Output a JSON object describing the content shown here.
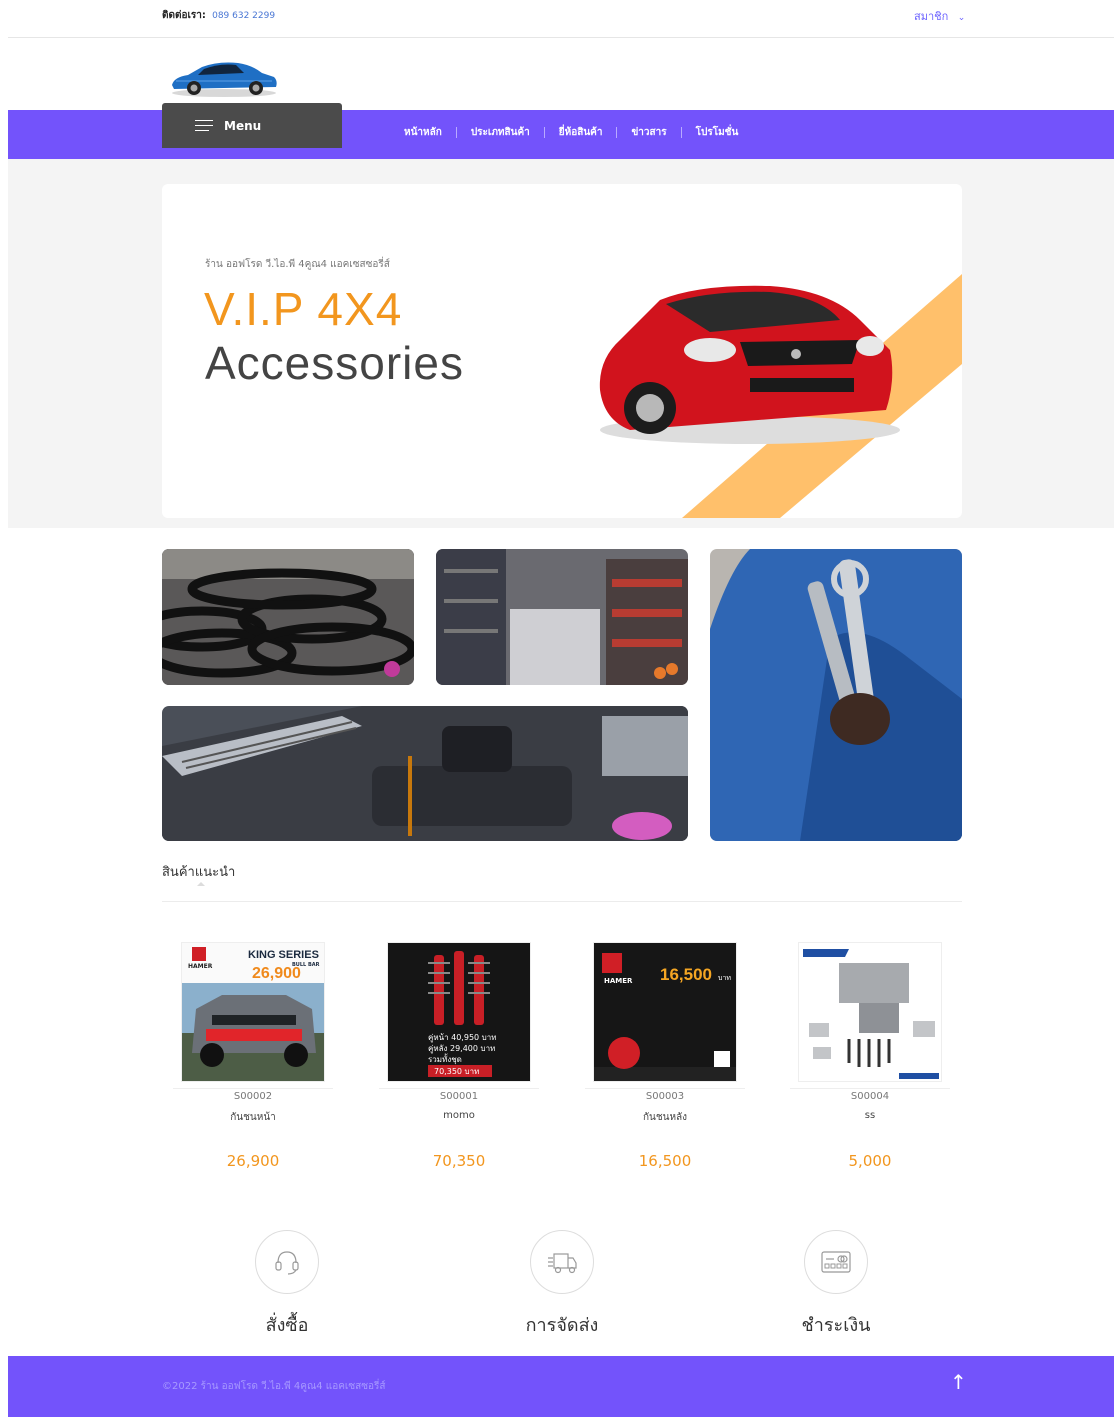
{
  "topbar": {
    "contact_label": "ติดต่อเรา:",
    "phone": "089 632 2299",
    "member_label": "สมาชิก",
    "member_icon": "chevron-down-icon"
  },
  "nav": {
    "menu_label": "Menu",
    "items": [
      "หน้าหลัก",
      "ประเภทสินค้า",
      "ยี่ห้อสินค้า",
      "ข่าวสาร",
      "โปรโมชั่น"
    ]
  },
  "hero": {
    "shop_name": "ร้าน ออฟโรด วี.ไอ.พี 4คูณ4 แอคเซสซอรี่ส์",
    "title_line1": "V.I.P 4X4",
    "title_line2": "Accessories",
    "accent_color": "#f2961e",
    "stripe_color": "#ffc06b"
  },
  "recommended": {
    "title": "สินค้าแนะนำ",
    "products": [
      {
        "code": "S00002",
        "name": "กันชนหน้า",
        "price": "26,900",
        "img_title": "KING SERIES",
        "img_sub": "BULL BAR",
        "img_price": "26,900",
        "img_brand": "HAMER"
      },
      {
        "code": "S00001",
        "name": "momo",
        "price": "70,350",
        "img_line1": "คู่หน้า 40,950 บาท",
        "img_line2": "คู่หลัง 29,400 บาท",
        "img_line3": "รวมทั้งชุด",
        "img_total": "70,350 บาท"
      },
      {
        "code": "S00003",
        "name": "กันชนหลัง",
        "price": "16,500",
        "img_price": "16,500",
        "img_unit": "บาท",
        "img_brand": "HAMER"
      },
      {
        "code": "S00004",
        "name": "ss",
        "price": "5,000"
      }
    ]
  },
  "features": [
    {
      "title": "สั่งซื้อ",
      "icon": "headset-icon"
    },
    {
      "title": "การจัดส่ง",
      "icon": "delivery-truck-icon"
    },
    {
      "title": "ชำระเงิน",
      "icon": "credit-card-icon"
    }
  ],
  "footer": {
    "copyright": "©2022 ร้าน ออฟโรด วี.ไอ.พี 4คูณ4 แอคเซสซอรี่ส์",
    "up_arrow": "↑"
  },
  "colors": {
    "brand_purple": "#7353fb",
    "menu_dark": "#4b4b4b",
    "price_orange": "#f2961e"
  }
}
